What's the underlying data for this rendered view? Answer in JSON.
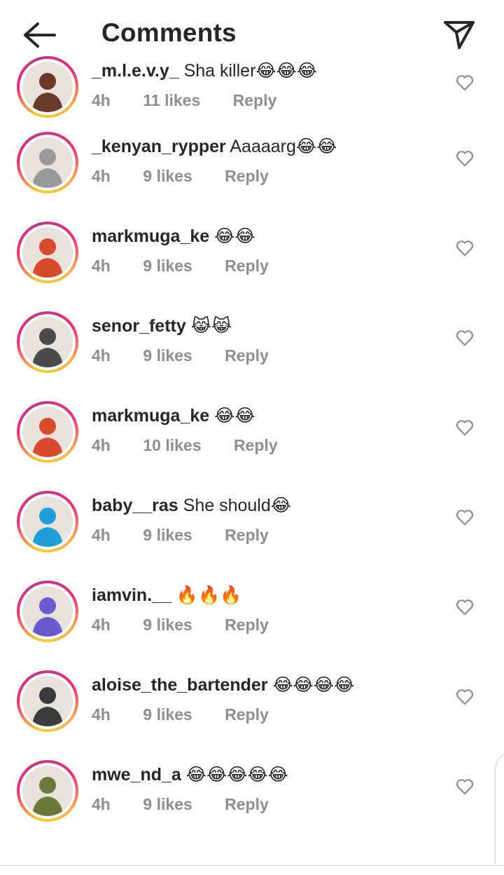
{
  "header": {
    "title": "Comments",
    "back_icon": "arrow-left-icon",
    "share_icon": "paper-plane-icon"
  },
  "comments": [
    {
      "username": "_m.l.e.v.y_",
      "text": "Sha killer😂😂😂",
      "time": "4h",
      "likes": "11 likes",
      "reply": "Reply",
      "avatar_color": "#6b3a2a"
    },
    {
      "username": "_kenyan_rypper",
      "text": "Aaaaarg😂😂",
      "time": "4h",
      "likes": "9 likes",
      "reply": "Reply",
      "avatar_color": "#9a9a9a"
    },
    {
      "username": "markmuga_ke",
      "text": "😂😂",
      "time": "4h",
      "likes": "9 likes",
      "reply": "Reply",
      "avatar_color": "#d94a2b"
    },
    {
      "username": "senor_fetty",
      "text": "😹😹",
      "time": "4h",
      "likes": "9 likes",
      "reply": "Reply",
      "avatar_color": "#4a4a4a"
    },
    {
      "username": "markmuga_ke",
      "text": "😂😂",
      "time": "4h",
      "likes": "10 likes",
      "reply": "Reply",
      "avatar_color": "#d94a2b"
    },
    {
      "username": "baby__ras",
      "text": "She should😂",
      "time": "4h",
      "likes": "9 likes",
      "reply": "Reply",
      "avatar_color": "#1e9fd8"
    },
    {
      "username": "iamvin.__",
      "text": "🔥🔥🔥",
      "time": "4h",
      "likes": "9 likes",
      "reply": "Reply",
      "avatar_color": "#6a5acd"
    },
    {
      "username": "aloise_the_bartender",
      "text": "😂😂😂😂",
      "time": "4h",
      "likes": "9 likes",
      "reply": "Reply",
      "avatar_color": "#3b3b3b"
    },
    {
      "username": "mwe_nd_a",
      "text": "😂😂😂😂😂",
      "time": "4h",
      "likes": "9 likes",
      "reply": "Reply",
      "avatar_color": "#6b7a3a"
    }
  ],
  "colors": {
    "text": "#262626",
    "meta": "#8e8e8e",
    "ring_start": "#f9ce34",
    "ring_mid": "#ee2a7b"
  }
}
